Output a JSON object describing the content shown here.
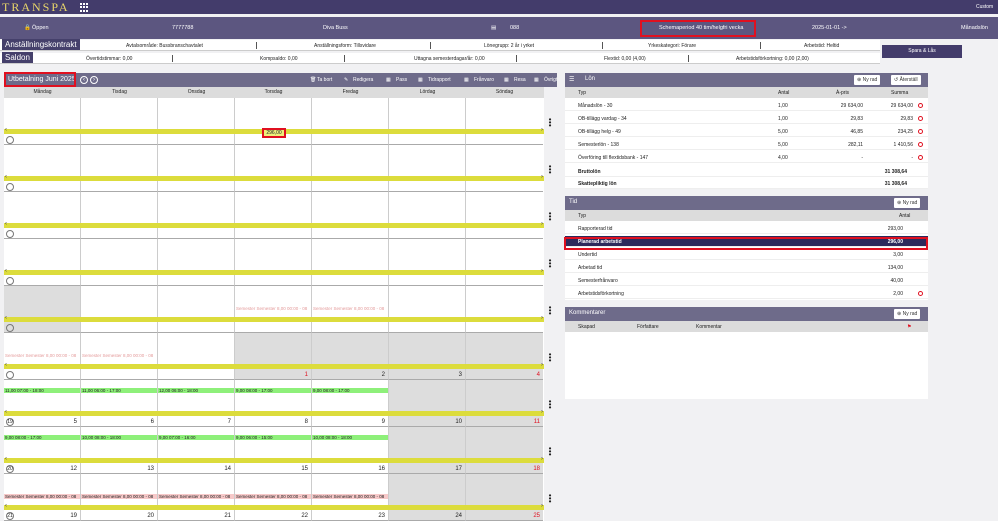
{
  "app": {
    "logo": "TRANSPA",
    "top_right": "Custom"
  },
  "infobar": {
    "status": "Öppen",
    "employee_id": "7777788",
    "company": "Diva Buss",
    "card_id": "088",
    "schema_period": "Schemaperiod 40 tim/helgfri vecka",
    "date": "2025-01-01 ->",
    "pay_type": "Månadslön"
  },
  "contract": {
    "title": "Anställningskontrakt",
    "area": "Avtalsområde: Bussbranschavtalet",
    "form": "Anställningsform: Tillsvidare",
    "wage_group": "Lönegrupp: 2 år i yrket",
    "category": "Yrkeskategori: Förare",
    "work_time": "Arbetstid: Heltid"
  },
  "balances": {
    "title": "Saldon",
    "overtime": "Övertidstimmar: 0,00",
    "comp": "Kompsaldo: 0,00",
    "vacation": "Uttagna semesterdagar/år: 0,00",
    "flex": "Flextid: 0,00 (4,00)",
    "shortening": "Arbetstidsförkortning: 0,00 (2,00)"
  },
  "spara_label": "Spara & Lås",
  "calendar": {
    "title": "Utbetalning Juni 2025",
    "toolbar": [
      "Ta bort",
      "Redigera",
      "Pass",
      "Tidrapport",
      "Frånvaro",
      "Resa",
      "Övrigt"
    ],
    "days": [
      "Måndag",
      "Tisdag",
      "Onsdag",
      "Torsdag",
      "Fredag",
      "Lördag",
      "Söndag"
    ],
    "marker_value": "296,00",
    "weeks": [
      {
        "week": "",
        "days": [
          "",
          "",
          "",
          "",
          "",
          "",
          ""
        ]
      },
      {
        "week": "",
        "days": [
          "",
          "",
          "",
          "",
          "",
          "",
          ""
        ]
      },
      {
        "week": "",
        "days": [
          "",
          "",
          "",
          "",
          "",
          "",
          ""
        ]
      },
      {
        "week": "",
        "days": [
          "",
          "",
          "",
          "",
          "",
          "",
          ""
        ]
      },
      {
        "week": "",
        "days": [
          "",
          "",
          "",
          "",
          "",
          "",
          ""
        ]
      },
      {
        "week": "",
        "days": [
          "",
          "",
          "",
          "1",
          "2",
          "3",
          "4"
        ]
      },
      {
        "week": "19",
        "days": [
          "5",
          "6",
          "7",
          "8",
          "9",
          "10",
          "11"
        ]
      },
      {
        "week": "20",
        "days": [
          "12",
          "13",
          "14",
          "15",
          "16",
          "17",
          "18"
        ]
      },
      {
        "week": "21",
        "days": [
          "19",
          "20",
          "21",
          "22",
          "23",
          "24",
          "25"
        ]
      }
    ],
    "events_w19": [
      "11,00 07:00 - 18:00",
      "11,00 06:00 - 17:00",
      "12,00 06:00 - 18:00",
      "9,00 08:00 - 17:00",
      "9,00 08:00 - 17:00"
    ],
    "events_w20": [
      "9,00 08:00 - 17:00",
      "10,00 08:00 - 18:00",
      "9,00 07:00 - 16:00",
      "9,00 06:00 - 15:00",
      "10,00 08:00 - 18:00"
    ],
    "semester_label": "Semester Semester 8,00 00:00 - 08",
    "semester_faint": "Semester Semester 8,00 00:00 - 08"
  },
  "lon": {
    "title": "Lön",
    "new_row": "Ny rad",
    "restore": "Återställ",
    "columns": [
      "Typ",
      "Antal",
      "À-pris",
      "Summa"
    ],
    "rows": [
      {
        "typ": "Månadslön - 30",
        "antal": "1,00",
        "apris": "29 634,00",
        "summa": "29 634,00"
      },
      {
        "typ": "OB-tillägg vardag - 34",
        "antal": "1,00",
        "apris": "29,83",
        "summa": "29,83"
      },
      {
        "typ": "OB-tillägg helg - 49",
        "antal": "5,00",
        "apris": "46,85",
        "summa": "234,25"
      },
      {
        "typ": "Semesterlön - 138",
        "antal": "5,00",
        "apris": "282,11",
        "summa": "1 410,56"
      },
      {
        "typ": "Överföring till flextidsbank - 147",
        "antal": "4,00",
        "apris": "-",
        "summa": "-"
      }
    ],
    "brutto_label": "Bruttolön",
    "brutto_value": "31 308,64",
    "skatt_label": "Skattepliktig lön",
    "skatt_value": "31 308,64"
  },
  "tid": {
    "title": "Tid",
    "new_row": "Ny rad",
    "columns": [
      "Typ",
      "Antal"
    ],
    "rows": [
      {
        "typ": "Rapporterad tid",
        "antal": "293,00"
      },
      {
        "typ": "Planerad arbetstid",
        "antal": "296,00"
      },
      {
        "typ": "Undertid",
        "antal": "3,00"
      },
      {
        "typ": "Arbetad tid",
        "antal": "134,00"
      },
      {
        "typ": "Semesterfrånvaro",
        "antal": "40,00"
      },
      {
        "typ": "Arbetstidsförkortning",
        "antal": "2,00"
      }
    ]
  },
  "kommentarer": {
    "title": "Kommentarer",
    "new_row": "Ny rad",
    "columns": [
      "Skapad",
      "Författare",
      "Kommentar"
    ]
  }
}
